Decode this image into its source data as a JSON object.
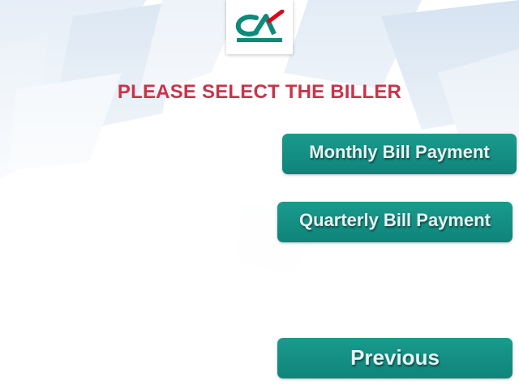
{
  "header": {
    "logo_icon": "credit-agricole-logo"
  },
  "title": "PLEASE SELECT THE BILLER",
  "options": {
    "monthly_label": "Monthly Bill Payment",
    "quarterly_label": "Quarterly Bill Payment"
  },
  "navigation": {
    "previous_label": "Previous"
  },
  "colors": {
    "title": "#c8344a",
    "button": "#11897e",
    "button_text": "#e8f4f2",
    "logo_green": "#0d8a7a",
    "logo_red": "#e2001a"
  }
}
